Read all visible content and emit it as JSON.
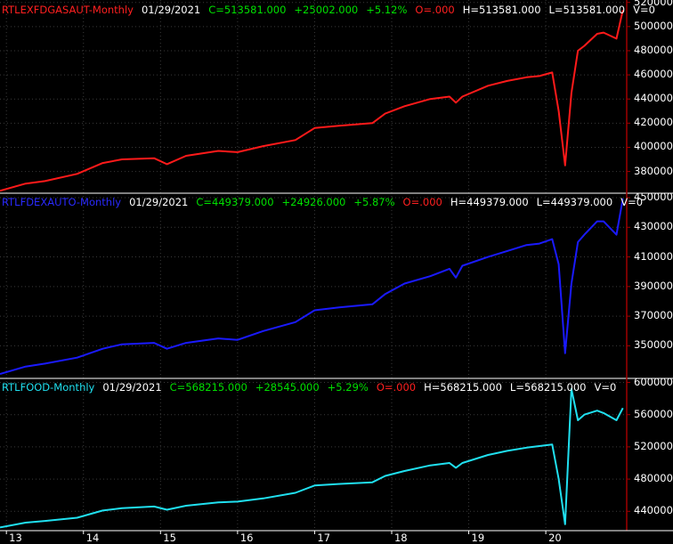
{
  "colors": {
    "background": "#000000",
    "axis_border": "#a00000",
    "grid": "#3a3a3a",
    "panel_divider": "#ffffff",
    "positive": "#00e000",
    "negative": "#ff2020",
    "neutral": "#ffffff"
  },
  "chart_data": [
    {
      "type": "line",
      "series": [
        {
          "name": "RTLEXFDGASAUT-Monthly",
          "color": "#ff1a1a"
        }
      ],
      "header": {
        "symbol": "RTLEXFDGASAUT-Monthly",
        "date": "01/29/2021",
        "close": "C=513581.000",
        "change": "+25002.000",
        "pct": "+5.12%",
        "open": "O=.000",
        "high": "H=513581.000",
        "low": "L=513581.000",
        "volume": "V=0"
      },
      "ylim": [
        362000,
        522000
      ],
      "yticks": [
        380000,
        400000,
        420000,
        440000,
        460000,
        480000,
        500000,
        520000
      ],
      "ytick_labels": [
        "380000.",
        "400000.",
        "420000.",
        "440000.",
        "460000.",
        "480000.",
        "500000.",
        "520000."
      ],
      "x": [
        2012.917,
        2013.25,
        2013.5,
        2013.917,
        2014.25,
        2014.5,
        2014.917,
        2015.083,
        2015.333,
        2015.75,
        2016.0,
        2016.333,
        2016.75,
        2017.0,
        2017.333,
        2017.75,
        2017.917,
        2018.167,
        2018.5,
        2018.75,
        2018.833,
        2018.917,
        2019.25,
        2019.5,
        2019.75,
        2019.917,
        2020.083,
        2020.167,
        2020.25,
        2020.333,
        2020.417,
        2020.5,
        2020.667,
        2020.75,
        2020.917,
        2021.0
      ],
      "values": [
        364000,
        370000,
        372000,
        378000,
        387000,
        390000,
        391000,
        386000,
        393000,
        397000,
        396000,
        401000,
        406000,
        416000,
        418000,
        420000,
        428000,
        434000,
        440000,
        442000,
        437000,
        442000,
        451000,
        455000,
        458000,
        459000,
        462000,
        430000,
        385000,
        445000,
        480000,
        484000,
        494000,
        495000,
        490000,
        513581
      ]
    },
    {
      "type": "line",
      "series": [
        {
          "name": "RTLFDEXAUTO-Monthly",
          "color": "#1a1aff"
        }
      ],
      "header": {
        "symbol": "RTLFDEXAUTO-Monthly",
        "date": "01/29/2021",
        "close": "C=449379.000",
        "change": "+24926.000",
        "pct": "+5.87%",
        "open": "O=.000",
        "high": "H=449379.000",
        "low": "L=449379.000",
        "volume": "V=0"
      },
      "ylim": [
        328000,
        453000
      ],
      "yticks": [
        350000,
        370000,
        390000,
        410000,
        430000,
        450000
      ],
      "ytick_labels": [
        "350000.",
        "370000.",
        "390000.",
        "410000.",
        "430000.",
        "450000."
      ],
      "x": [
        2012.917,
        2013.25,
        2013.5,
        2013.917,
        2014.25,
        2014.5,
        2014.917,
        2015.083,
        2015.333,
        2015.75,
        2016.0,
        2016.333,
        2016.75,
        2017.0,
        2017.333,
        2017.75,
        2017.917,
        2018.167,
        2018.5,
        2018.75,
        2018.833,
        2018.917,
        2019.25,
        2019.5,
        2019.75,
        2019.917,
        2020.083,
        2020.167,
        2020.25,
        2020.333,
        2020.417,
        2020.5,
        2020.667,
        2020.75,
        2020.917,
        2021.0
      ],
      "values": [
        331000,
        336000,
        338000,
        342000,
        348000,
        351000,
        352000,
        348000,
        352000,
        355000,
        354000,
        360000,
        366000,
        374000,
        376000,
        378000,
        385000,
        392000,
        397000,
        402000,
        396000,
        404000,
        410000,
        414000,
        418000,
        419000,
        422000,
        405000,
        345000,
        392000,
        420000,
        425000,
        434000,
        434000,
        425000,
        449379
      ]
    },
    {
      "type": "line",
      "series": [
        {
          "name": "RTLFOOD-Monthly",
          "color": "#20e0f0"
        }
      ],
      "header": {
        "symbol": "RTLFOOD-Monthly",
        "date": "01/29/2021",
        "close": "C=568215.000",
        "change": "+28545.000",
        "pct": "+5.29%",
        "open": "O=.000",
        "high": "H=568215.000",
        "low": "L=568215.000",
        "volume": "V=0"
      },
      "ylim": [
        416000,
        605000
      ],
      "yticks": [
        440000,
        480000,
        520000,
        560000,
        600000
      ],
      "ytick_labels": [
        "440000.",
        "480000.",
        "520000.",
        "560000.",
        "600000."
      ],
      "x": [
        2012.917,
        2013.25,
        2013.5,
        2013.917,
        2014.25,
        2014.5,
        2014.917,
        2015.083,
        2015.333,
        2015.75,
        2016.0,
        2016.333,
        2016.75,
        2017.0,
        2017.333,
        2017.75,
        2017.917,
        2018.167,
        2018.5,
        2018.75,
        2018.833,
        2018.917,
        2019.25,
        2019.5,
        2019.75,
        2019.917,
        2020.083,
        2020.167,
        2020.25,
        2020.333,
        2020.417,
        2020.5,
        2020.667,
        2020.75,
        2020.917,
        2021.0
      ],
      "values": [
        420000,
        426000,
        428000,
        432000,
        441000,
        444000,
        446000,
        442000,
        447000,
        451000,
        452000,
        456000,
        463000,
        472000,
        474000,
        476000,
        484000,
        490000,
        497000,
        500000,
        494000,
        500000,
        510000,
        515000,
        519000,
        521000,
        523000,
        480000,
        424000,
        592000,
        553000,
        560000,
        565000,
        562000,
        553000,
        568215
      ]
    }
  ],
  "x_axis": {
    "type": "time",
    "xlim": [
      2012.917,
      2021.05
    ],
    "ticks": [
      2013,
      2014,
      2015,
      2016,
      2017,
      2018,
      2019,
      2020
    ],
    "tick_labels": [
      "13",
      "14",
      "15",
      "16",
      "17",
      "18",
      "19",
      "20"
    ]
  },
  "grid": true
}
